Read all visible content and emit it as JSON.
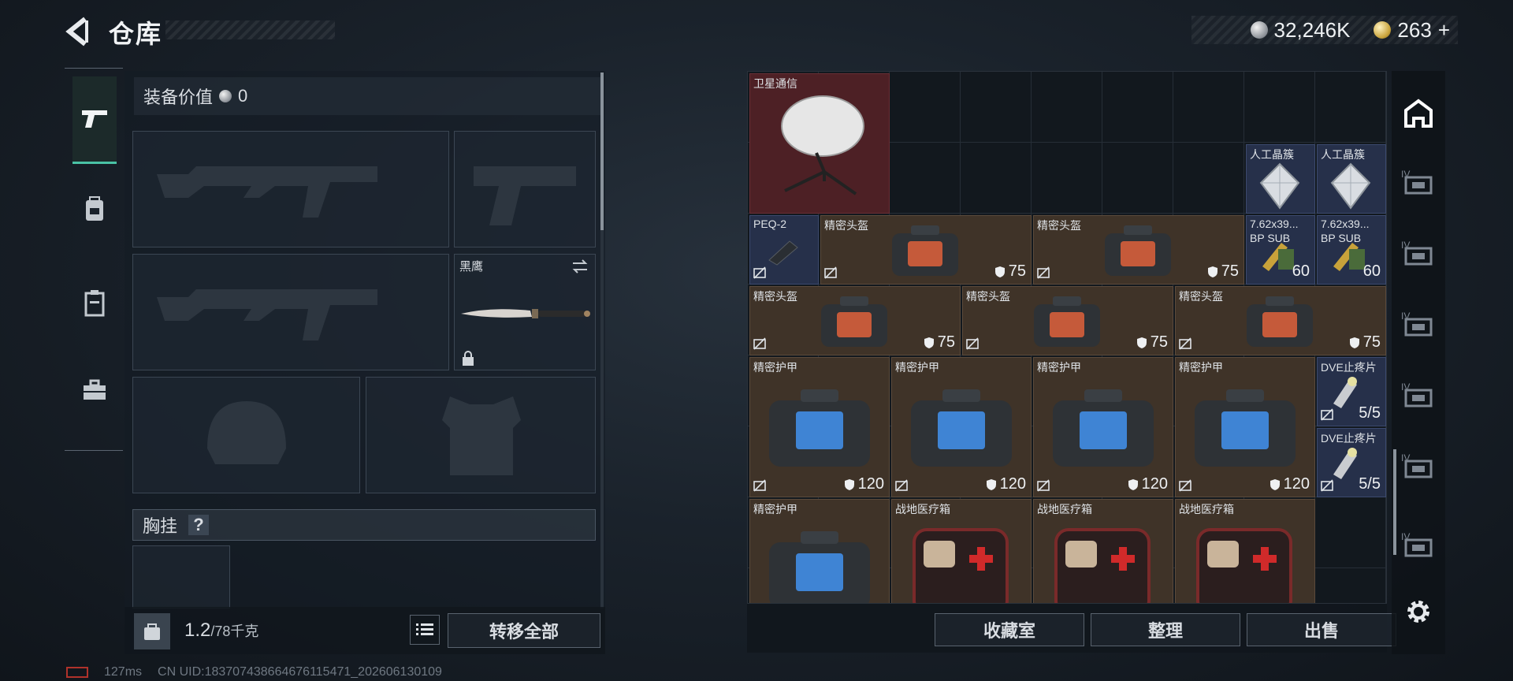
{
  "header": {
    "title": "仓库",
    "currency_silver": "32,246K",
    "currency_gold": "263",
    "currency_gold_add": "+"
  },
  "loadout": {
    "equip_value_label": "装备价值",
    "equip_value": "0",
    "melee_name": "黑鹰",
    "chest_rig_label": "胸挂",
    "chest_rig_help": "?",
    "weight_current": "1.2",
    "weight_max": "/78千克",
    "transfer_all": "转移全部"
  },
  "status": {
    "ping": "127ms",
    "uid": "CN UID:183707438664676115471_202606130109"
  },
  "storage": {
    "items": [
      {
        "name": "卫星通信",
        "value": ""
      },
      {
        "name": "人工晶簇",
        "value": ""
      },
      {
        "name": "人工晶簇",
        "value": ""
      },
      {
        "name": "PEQ-2",
        "value": ""
      },
      {
        "name": "精密头盔",
        "value": "75"
      },
      {
        "name": "精密头盔",
        "value": "75"
      },
      {
        "name": "7.62x39...",
        "sub": "BP SUB",
        "value": "60"
      },
      {
        "name": "7.62x39...",
        "sub": "BP SUB",
        "value": "60"
      },
      {
        "name": "精密头盔",
        "value": "75"
      },
      {
        "name": "精密头盔",
        "value": "75"
      },
      {
        "name": "精密头盔",
        "value": "75"
      },
      {
        "name": "精密护甲",
        "value": "120"
      },
      {
        "name": "精密护甲",
        "value": "120"
      },
      {
        "name": "精密护甲",
        "value": "120"
      },
      {
        "name": "精密护甲",
        "value": "120"
      },
      {
        "name": "DVE止疼片",
        "value": "5/5"
      },
      {
        "name": "DVE止疼片",
        "value": "5/5"
      },
      {
        "name": "精密护甲",
        "value": ""
      },
      {
        "name": "战地医疗箱",
        "value": ""
      },
      {
        "name": "战地医疗箱",
        "value": ""
      },
      {
        "name": "战地医疗箱",
        "value": ""
      }
    ],
    "collection_button": "收藏室",
    "sort_button": "整理",
    "sell_button": "出售",
    "tab_level": "IV"
  },
  "colors": {
    "accent": "#49c2a5",
    "item_brown": "#3f3328",
    "item_red": "#4d2025",
    "item_blue": "#26304a"
  }
}
